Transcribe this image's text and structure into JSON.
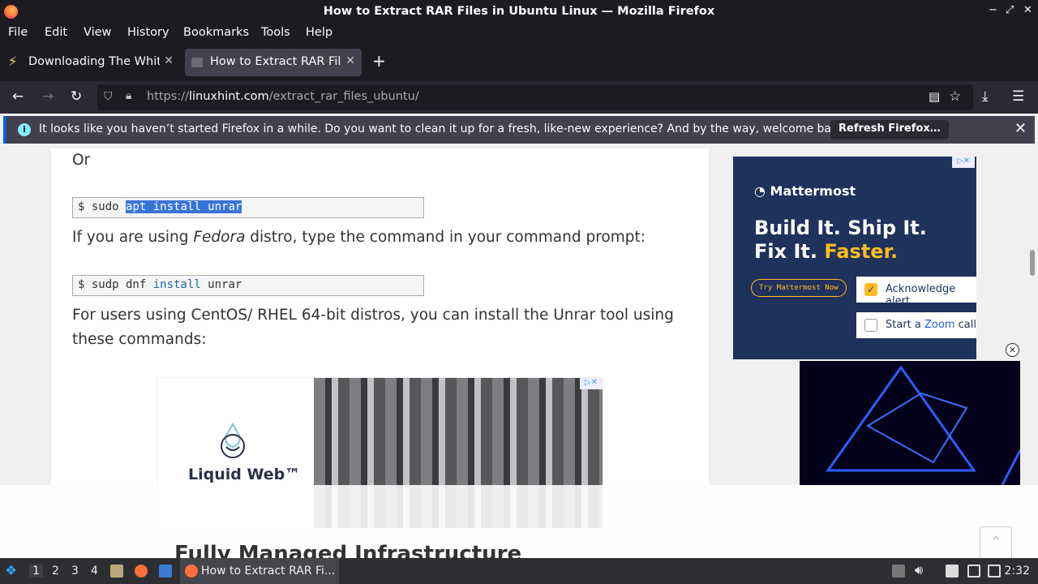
{
  "window": {
    "title": "How to Extract RAR Files in Ubuntu Linux — Mozilla Firefox",
    "controls": [
      "−",
      "⤢",
      "✕"
    ]
  },
  "menu": [
    "File",
    "Edit",
    "View",
    "History",
    "Bookmarks",
    "Tools",
    "Help"
  ],
  "tabs": [
    {
      "label": "Downloading The White House...",
      "active": false
    },
    {
      "label": "How to Extract RAR Files",
      "active": true
    }
  ],
  "nav": {
    "url_prefix": "https://",
    "url_domain": "linuxhint.com",
    "url_path": "/extract_rar_files_ubuntu/"
  },
  "notification": {
    "message": "It looks like you haven’t started Firefox in a while. Do you want to clean it up for a fresh, like-new experience? And by the way, welcome back!",
    "button": "Refresh Firefox…"
  },
  "article": {
    "or_text": "Or",
    "code1": {
      "prompt": "$ sudo ",
      "selected": "apt install unrar"
    },
    "fedora_pre": "If you are using ",
    "fedora_em": "Fedora",
    "fedora_post": " distro, type the command in your command prompt:",
    "code2": {
      "pre": "$ sudp dnf ",
      "kw": "install",
      "post": " unrar"
    },
    "centos_line1": "For users using CentOS/ RHEL 64-bit distros, you can install the Unrar tool using",
    "centos_line2": "these commands:"
  },
  "ad_mattermost": {
    "logo": "Mattermost",
    "headline1": "Build It. Ship It.",
    "headline2a": "Fix It. ",
    "headline2b": "Faster.",
    "cta": "Try Mattermost Now",
    "check1": "Acknowledge alert",
    "check2_pre": "Start a ",
    "check2_link": "Zoom",
    "check2_post": " call"
  },
  "ad_liquidweb": {
    "brand": "Liquid Web™",
    "overlay_heading": "Fully Managed Infrastructure"
  },
  "taskbar": {
    "workspaces": [
      "1",
      "2",
      "3",
      "4"
    ],
    "app_label": "How to Extract RAR Fi...",
    "clock": "2:32"
  },
  "colors": {
    "accent": "#0060df",
    "ad_bg": "#1e325c",
    "ad_yellow": "#ffbc1f"
  }
}
